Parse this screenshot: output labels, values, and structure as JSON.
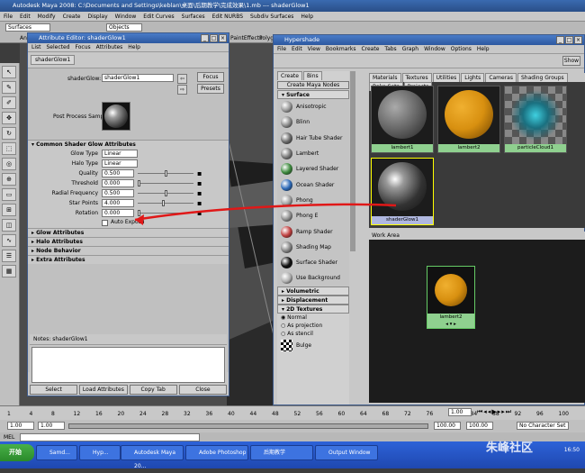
{
  "window": {
    "title": "Autodesk Maya 2008: C:\\Documents and Settings\\keblan\\桌面\\后期教学\\完成效果\\1.mb    ---    shaderGlow1"
  },
  "menubar": {
    "items": [
      "File",
      "Edit",
      "Modify",
      "Create",
      "Display",
      "Window",
      "Edit Curves",
      "Surfaces",
      "Edit NURBS",
      "Subdiv Surfaces",
      "Help"
    ]
  },
  "shelf": {
    "mode": "Surfaces",
    "objects_field": "Objects",
    "tab_partial": "Anim",
    "tab_paint": "PaintEffects",
    "tab_poly": "Polyg"
  },
  "attribute_editor": {
    "title": "Attribute Editor: shaderGlow1",
    "menu": [
      "List",
      "Selected",
      "Focus",
      "Attributes",
      "Help"
    ],
    "tab": "shaderGlow1",
    "node_label": "shaderGlow:",
    "node_value": "shaderGlow1",
    "focus_btn": "Focus",
    "presets_btn": "Presets",
    "sample_label": "Post Process Sample",
    "section_common": "Common Shader Glow Attributes",
    "rows": [
      {
        "label": "Glow Type",
        "value": "Linear"
      },
      {
        "label": "Halo Type",
        "value": "Linear"
      },
      {
        "label": "Quality",
        "value": "0.500"
      },
      {
        "label": "Threshold",
        "value": "0.000"
      },
      {
        "label": "Radial Frequency",
        "value": "0.500"
      },
      {
        "label": "Star Points",
        "value": "4.000"
      },
      {
        "label": "Rotation",
        "value": "0.000"
      }
    ],
    "auto_exposure": "Auto Exposu",
    "sections": [
      "Glow Attributes",
      "Halo Attributes",
      "Node Behavior",
      "Extra Attributes"
    ],
    "notes_label": "Notes:  shaderGlow1",
    "buttons": [
      "Select",
      "Load Attributes",
      "Copy Tab",
      "Close"
    ]
  },
  "hypershade": {
    "title": "Hypershade",
    "menu": [
      "File",
      "Edit",
      "View",
      "Bookmarks",
      "Create",
      "Tabs",
      "Graph",
      "Window",
      "Options",
      "Help"
    ],
    "show_btn": "Show",
    "create_tabs": [
      "Create",
      "Bins"
    ],
    "create_label": "Create Maya Nodes",
    "surface_header": "Surface",
    "nodes": [
      {
        "label": "Anisotropic",
        "color": "#9a9a9a"
      },
      {
        "label": "Blinn",
        "color": "#8a8a8a"
      },
      {
        "label": "Hair Tube Shader",
        "color": "#6a6a6a"
      },
      {
        "label": "Lambert",
        "color": "#7a7a7a"
      },
      {
        "label": "Layered Shader",
        "color": "#3d8a3d"
      },
      {
        "label": "Ocean Shader",
        "color": "#2d6ab8"
      },
      {
        "label": "Phong",
        "color": "#a0a0a0"
      },
      {
        "label": "Phong E",
        "color": "#909090"
      },
      {
        "label": "Ramp Shader",
        "color": "#c04040"
      },
      {
        "label": "Shading Map",
        "color": "#858585"
      },
      {
        "label": "Surface Shader",
        "color": "#101010"
      },
      {
        "label": "Use Background",
        "color": "#b0b0b0"
      }
    ],
    "more_sections": [
      "Volumetric",
      "Displacement",
      "2D Textures"
    ],
    "radio_options": [
      "Normal",
      "As projection",
      "As stencil"
    ],
    "bulge_label": "Bulge",
    "top_tabs": [
      "Materials",
      "Textures",
      "Utilities",
      "Lights",
      "Cameras",
      "Shading Groups",
      "Bake Sets",
      "Projects"
    ],
    "swatches": [
      "lambert1",
      "lambert2",
      "particleCloud1",
      "shaderGlow1"
    ],
    "work_area_label": "Work Area",
    "work_node": "lambert2"
  },
  "timeline": {
    "ticks": [
      "1",
      "4",
      "8",
      "12",
      "16",
      "20",
      "24",
      "28",
      "32",
      "36",
      "40",
      "44",
      "48",
      "52",
      "56",
      "60",
      "64",
      "68",
      "72",
      "76",
      "80",
      "84",
      "88",
      "92",
      "96",
      "100"
    ],
    "start": "1.00",
    "start2": "1.00",
    "end": "100.00",
    "end2": "100.00",
    "current": "1.00",
    "character_set": "No Character Set",
    "mel_label": "MEL"
  },
  "taskbar": {
    "start_label": "开始",
    "tasks": [
      "Samd...",
      "Hyp...",
      "Autodesk Maya 20...",
      "Adobe Photoshop",
      "后期教学",
      "Output Window"
    ],
    "clock": "16:50"
  },
  "watermark": "朱峰社区"
}
